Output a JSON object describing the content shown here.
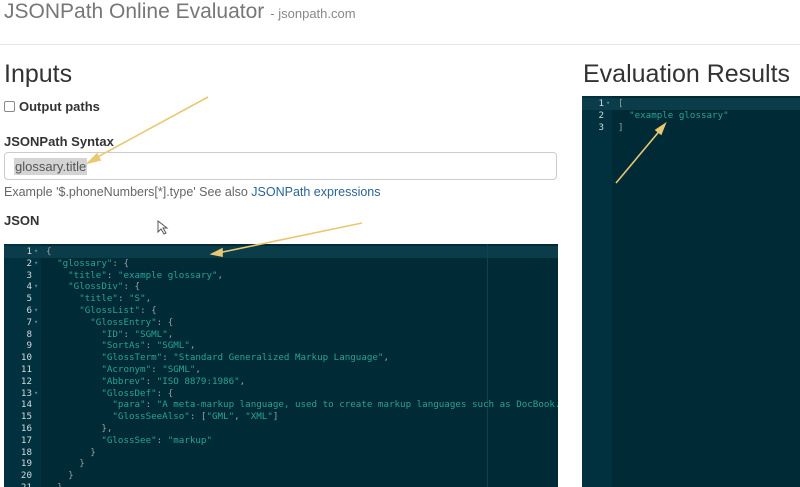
{
  "header": {
    "title": "JSONPath Online Evaluator",
    "subtitle": "- jsonpath.com"
  },
  "inputs": {
    "heading": "Inputs",
    "output_paths_label": "Output paths",
    "syntax_label": "JSONPath Syntax",
    "syntax_value": "glossary.title",
    "example_text": "Example '$.phoneNumbers[*].type' See also ",
    "example_link": "JSONPath expressions",
    "json_label": "JSON"
  },
  "json_editor": {
    "lines": [
      {
        "n": "1",
        "fold": true,
        "html": "<span class='p'>{</span>"
      },
      {
        "n": "2",
        "fold": true,
        "html": "  <span class='k'>\"glossary\"</span><span class='p'>: {</span>"
      },
      {
        "n": "3",
        "fold": false,
        "html": "    <span class='k'>\"title\"</span><span class='p'>: </span><span class='s'>\"example glossary\"</span><span class='p'>,</span>"
      },
      {
        "n": "4",
        "fold": true,
        "html": "    <span class='k'>\"GlossDiv\"</span><span class='p'>: {</span>"
      },
      {
        "n": "5",
        "fold": false,
        "html": "      <span class='k'>\"title\"</span><span class='p'>: </span><span class='s'>\"S\"</span><span class='p'>,</span>"
      },
      {
        "n": "6",
        "fold": true,
        "html": "      <span class='k'>\"GlossList\"</span><span class='p'>: {</span>"
      },
      {
        "n": "7",
        "fold": true,
        "html": "        <span class='k'>\"GlossEntry\"</span><span class='p'>: {</span>"
      },
      {
        "n": "8",
        "fold": false,
        "html": "          <span class='k'>\"ID\"</span><span class='p'>: </span><span class='s'>\"SGML\"</span><span class='p'>,</span>"
      },
      {
        "n": "9",
        "fold": false,
        "html": "          <span class='k'>\"SortAs\"</span><span class='p'>: </span><span class='s'>\"SGML\"</span><span class='p'>,</span>"
      },
      {
        "n": "10",
        "fold": false,
        "html": "          <span class='k'>\"GlossTerm\"</span><span class='p'>: </span><span class='s'>\"Standard Generalized Markup Language\"</span><span class='p'>,</span>"
      },
      {
        "n": "11",
        "fold": false,
        "html": "          <span class='k'>\"Acronym\"</span><span class='p'>: </span><span class='s'>\"SGML\"</span><span class='p'>,</span>"
      },
      {
        "n": "12",
        "fold": false,
        "html": "          <span class='k'>\"Abbrev\"</span><span class='p'>: </span><span class='s'>\"ISO 8879:1986\"</span><span class='p'>,</span>"
      },
      {
        "n": "13",
        "fold": true,
        "html": "          <span class='k'>\"GlossDef\"</span><span class='p'>: {</span>"
      },
      {
        "n": "14",
        "fold": false,
        "html": "            <span class='k'>\"para\"</span><span class='p'>: </span><span class='s'>\"A meta-markup language, used to create markup languages such as DocBook.\"</span><span class='p'>,</span>"
      },
      {
        "n": "15",
        "fold": false,
        "html": "            <span class='k'>\"GlossSeeAlso\"</span><span class='p'>: [</span><span class='s'>\"GML\"</span><span class='p'>, </span><span class='s'>\"XML\"</span><span class='p'>]</span>"
      },
      {
        "n": "16",
        "fold": false,
        "html": "          <span class='p'>},</span>"
      },
      {
        "n": "17",
        "fold": false,
        "html": "          <span class='k'>\"GlossSee\"</span><span class='p'>: </span><span class='s'>\"markup\"</span>"
      },
      {
        "n": "18",
        "fold": false,
        "html": "        <span class='p'>}</span>"
      },
      {
        "n": "19",
        "fold": false,
        "html": "      <span class='p'>}</span>"
      },
      {
        "n": "20",
        "fold": false,
        "html": "    <span class='p'>}</span>"
      },
      {
        "n": "21",
        "fold": false,
        "html": "  <span class='p'>}</span>"
      }
    ]
  },
  "results": {
    "heading": "Evaluation Results",
    "lines": [
      {
        "n": "1",
        "fold": true,
        "html": "<span class='p'>[</span>"
      },
      {
        "n": "2",
        "fold": false,
        "html": "  <span class='s'>\"example glossary\"</span>"
      },
      {
        "n": "3",
        "fold": false,
        "html": "<span class='p'>]</span>"
      }
    ]
  },
  "colors": {
    "editor_bg": "#002b36",
    "string": "#2aa198",
    "arrow": "#e8c872"
  }
}
